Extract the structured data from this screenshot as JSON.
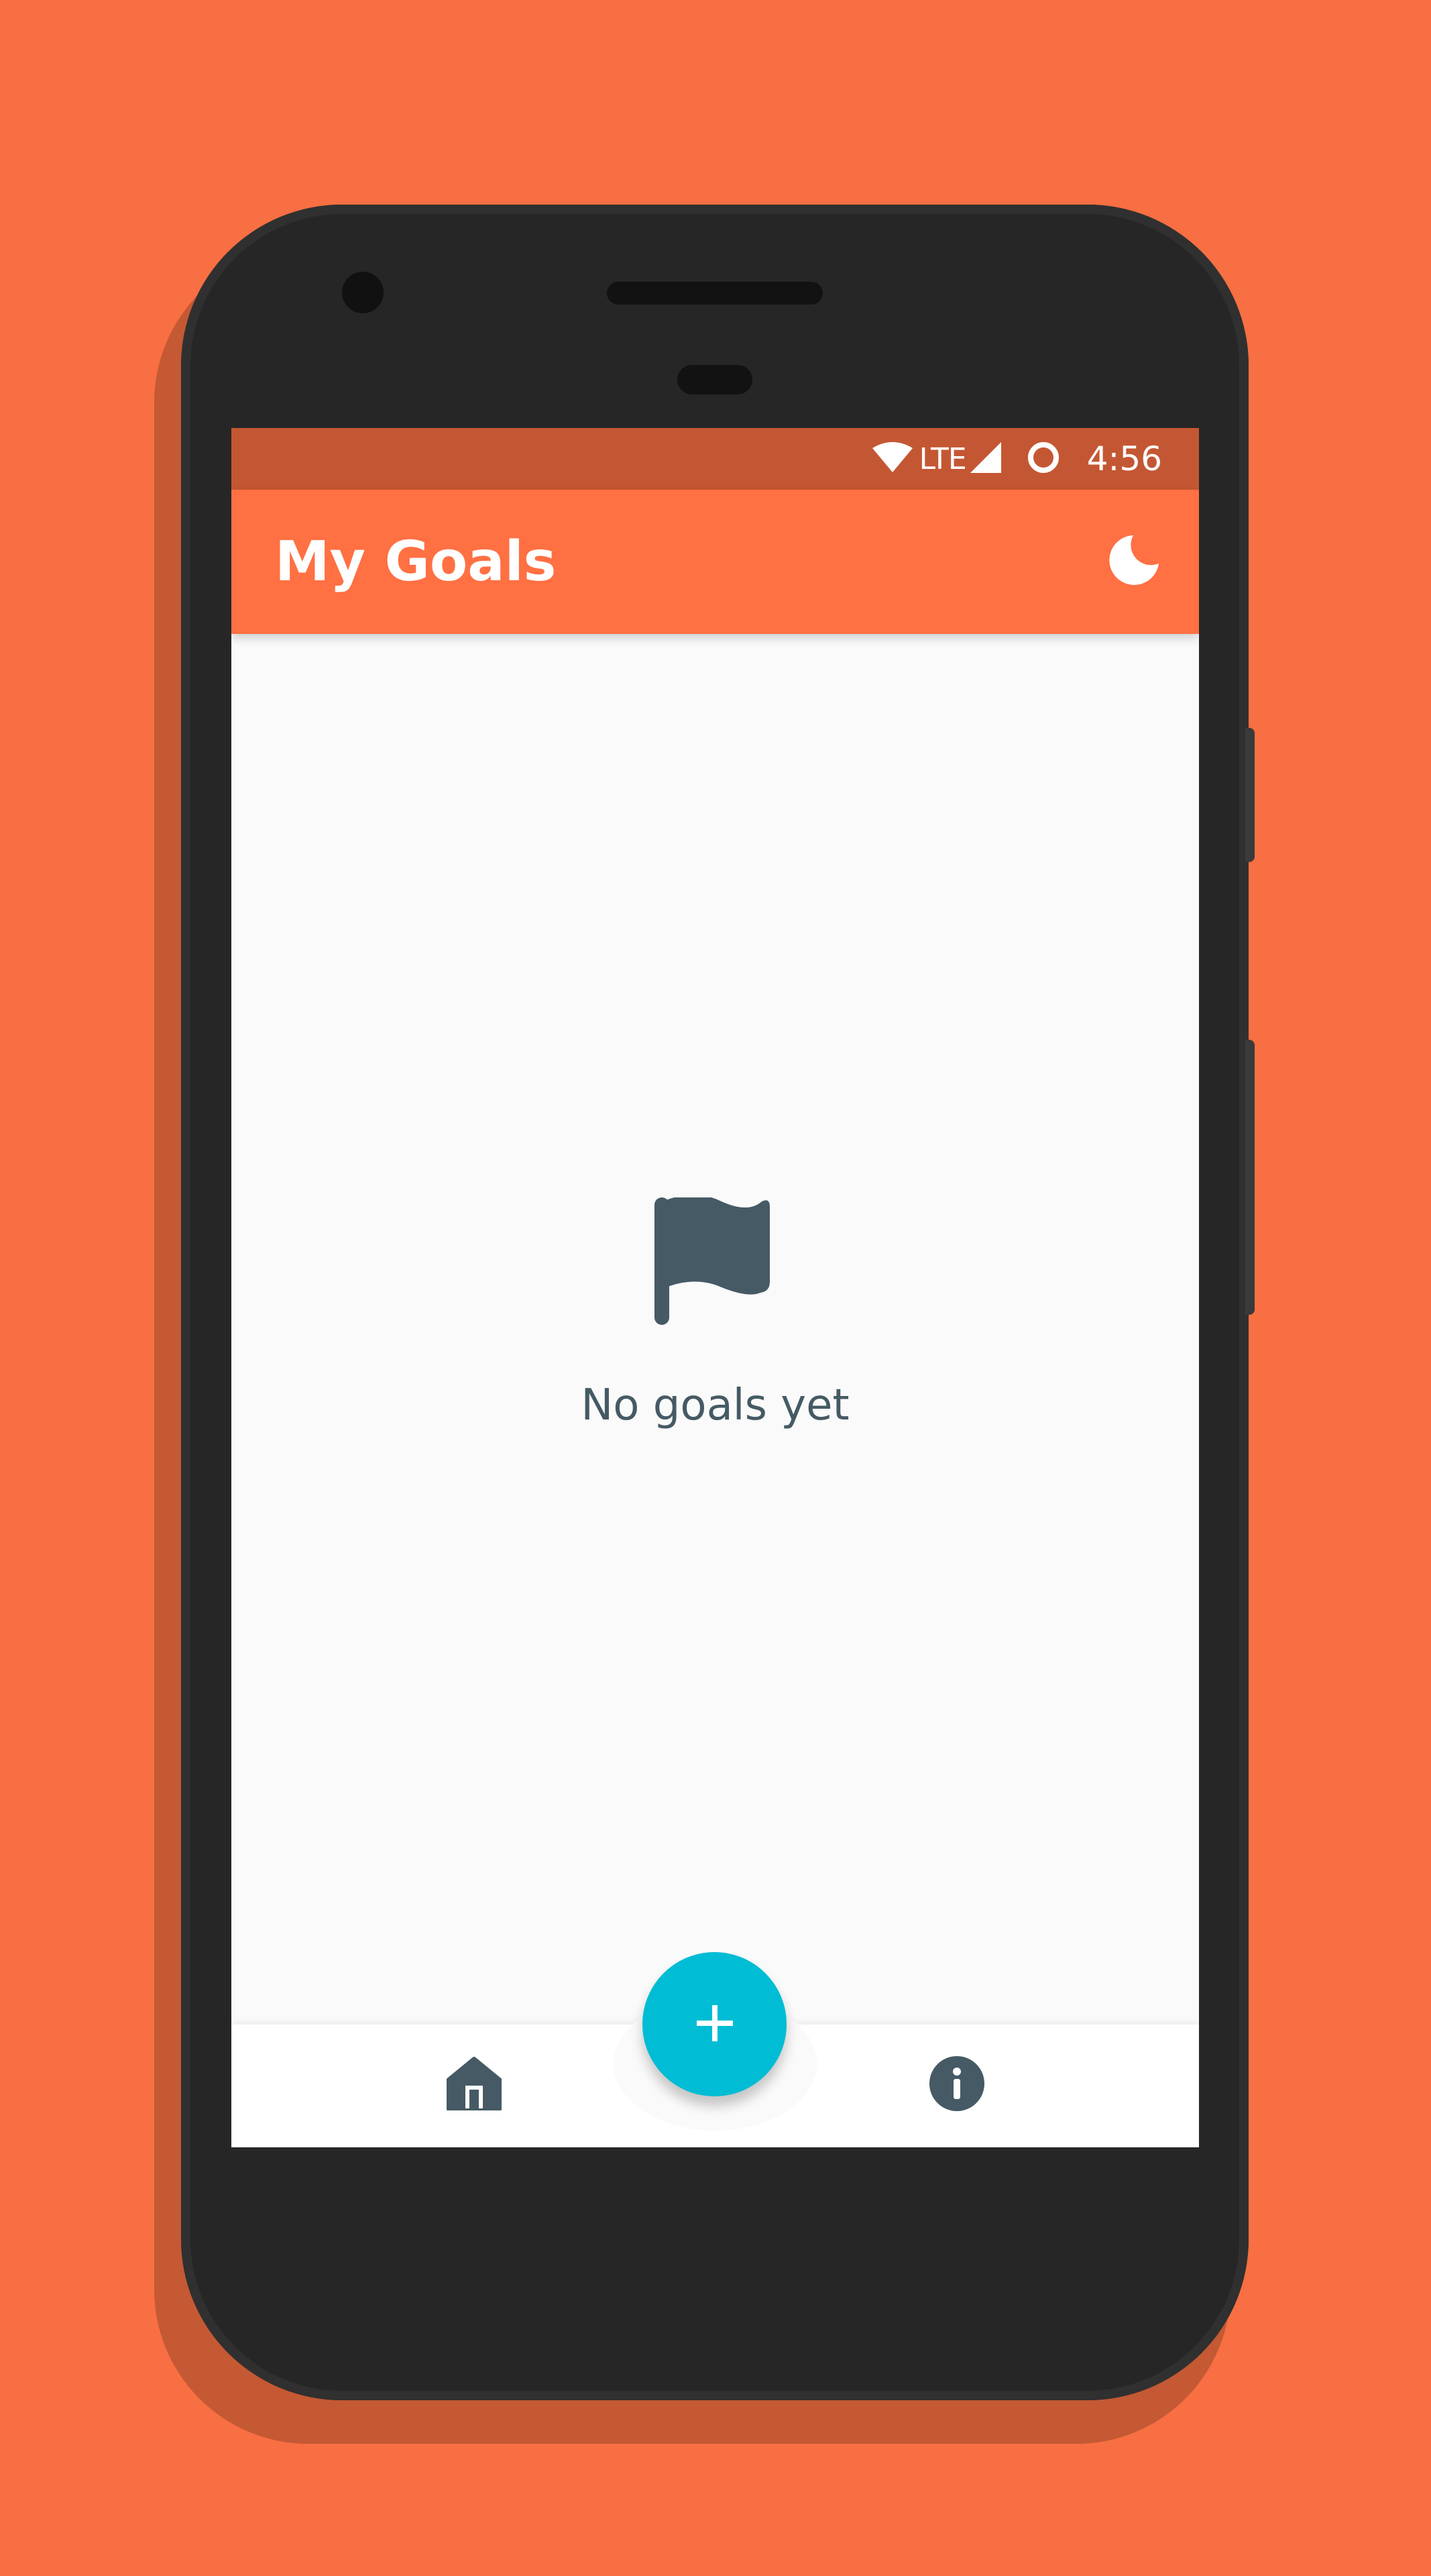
{
  "status_bar": {
    "network": "LTE",
    "time": "4:56",
    "icons": [
      "wifi-icon",
      "signal-icon",
      "sync-circle-icon"
    ]
  },
  "app_bar": {
    "title": "My Goals",
    "theme_toggle_icon": "moon-icon"
  },
  "empty_state": {
    "icon": "flag-icon",
    "message": "No goals yet"
  },
  "bottom_nav": {
    "home_icon": "home-icon",
    "info_icon": "info-icon",
    "fab_icon": "plus-icon"
  },
  "colors": {
    "background": "#f76f42",
    "app_bar": "#ff7043",
    "status_bar": "#c45733",
    "fab": "#00bcd4",
    "icon_dark": "#455a64",
    "surface": "#fafafa"
  }
}
